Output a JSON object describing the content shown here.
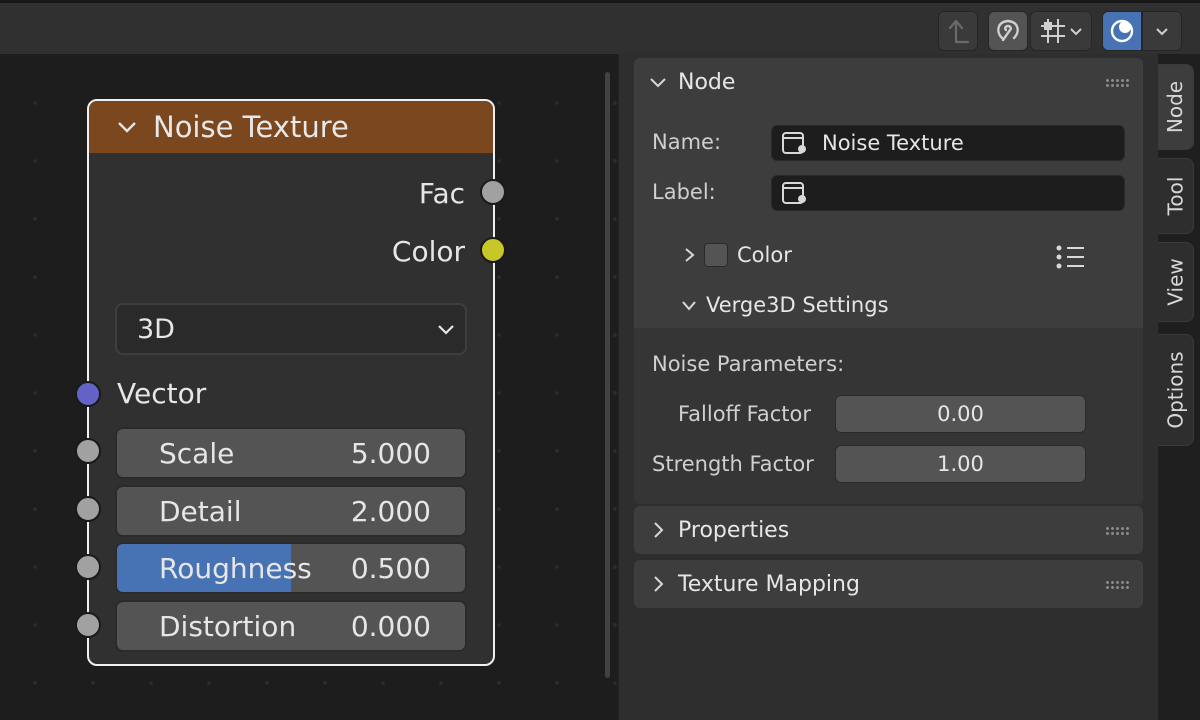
{
  "header": {
    "parent_icon": "arrow-up-icon",
    "snap_icon": "magnet-icon",
    "grid_icon": "grid-snap-icon",
    "overlay_icon": "overlay-icon"
  },
  "node": {
    "title": "Noise Texture",
    "header_color": "#7a471f",
    "outputs": [
      {
        "label": "Fac",
        "socket_color": "#a1a1a1"
      },
      {
        "label": "Color",
        "socket_color": "#c7c729"
      }
    ],
    "dimensions": "3D",
    "input_vector": {
      "label": "Vector",
      "socket_color": "#6363c7"
    },
    "inputs": [
      {
        "label": "Scale",
        "value": "5.000",
        "fill": 0
      },
      {
        "label": "Detail",
        "value": "2.000",
        "fill": 0
      },
      {
        "label": "Roughness",
        "value": "0.500",
        "fill": 0.5
      },
      {
        "label": "Distortion",
        "value": "0.000",
        "fill": 0
      }
    ]
  },
  "sidebar": {
    "node_panel": {
      "title": "Node",
      "name_label": "Name:",
      "name_value": "Noise Texture",
      "label_label": "Label:",
      "label_value": "",
      "color_label": "Color",
      "verge_title": "Verge3D Settings",
      "noise_params_label": "Noise Parameters:",
      "falloff_label": "Falloff Factor",
      "falloff_value": "0.00",
      "strength_label": "Strength Factor",
      "strength_value": "1.00"
    },
    "properties_title": "Properties",
    "texture_mapping_title": "Texture Mapping"
  },
  "tabs": [
    "Node",
    "Tool",
    "View",
    "Options"
  ],
  "colors": {
    "accent": "#4772b3",
    "overlay_button": "#4772b3"
  }
}
